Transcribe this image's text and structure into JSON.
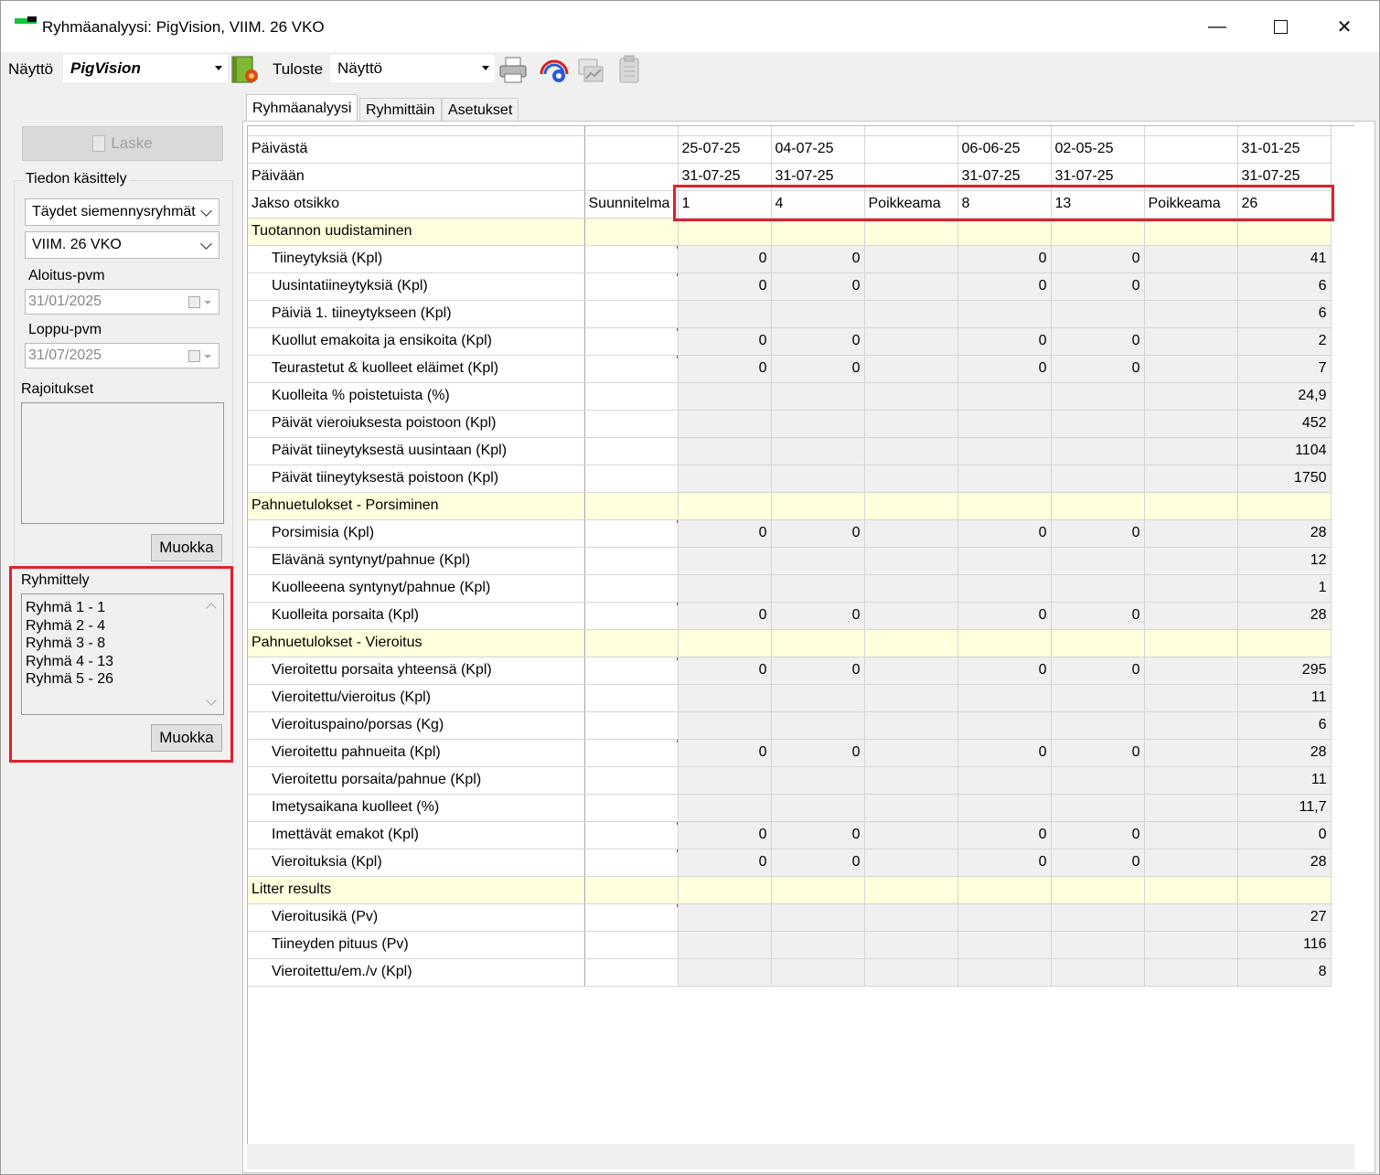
{
  "window": {
    "title": "Ryhmäanalyysi: PigVision, VIIM. 26 VKO",
    "minimize": "—",
    "close": "✕"
  },
  "toolbar": {
    "nayto_label": "Näyttö",
    "view_value": "PigVision",
    "tuloste_label": "Tuloste",
    "print_value": "Näyttö"
  },
  "left": {
    "laske_label": "Laske",
    "tiedon_kasittely": "Tiedon käsittely",
    "group_select": "Täydet siemennysryhmät",
    "period_select": "VIIM. 26 VKO",
    "aloitus_label": "Aloitus-pvm",
    "aloitus_value": "31/01/2025",
    "loppu_label": "Loppu-pvm",
    "loppu_value": "31/07/2025",
    "rajoitukset_label": "Rajoitukset",
    "muokka1": "Muokka",
    "ryhmittely_label": "Ryhmittely",
    "ryhmittely_items": [
      "Ryhmä 1 - 1",
      "Ryhmä 2 - 4",
      "Ryhmä 3 - 8",
      "Ryhmä 4 - 13",
      "Ryhmä 5 - 26"
    ],
    "muokka2": "Muokka"
  },
  "tabs": [
    "Ryhmäanalyysi",
    "Ryhmittäin",
    "Asetukset"
  ],
  "grid": {
    "header_rows": [
      {
        "label": "Päivästä",
        "plan": "",
        "cols": [
          "25-07-25",
          "04-07-25",
          "",
          "06-06-25",
          "02-05-25",
          "",
          "31-01-25"
        ]
      },
      {
        "label": "Päivään",
        "plan": "",
        "cols": [
          "31-07-25",
          "31-07-25",
          "",
          "31-07-25",
          "31-07-25",
          "",
          "31-07-25"
        ]
      },
      {
        "label": "Jakso otsikko",
        "plan": "Suunnitelma",
        "cols": [
          "1",
          "4",
          "Poikkeama",
          "8",
          "13",
          "Poikkeama",
          "26"
        ]
      }
    ],
    "sections": [
      {
        "title": "Tuotannon uudistaminen",
        "rows": [
          {
            "label": "Tiineytyksiä (Kpl)",
            "vals": [
              "0",
              "0",
              "",
              "0",
              "0",
              "",
              "41"
            ]
          },
          {
            "label": "Uusintatiineytyksiä (Kpl)",
            "vals": [
              "0",
              "0",
              "",
              "0",
              "0",
              "",
              "6"
            ]
          },
          {
            "label": "Päiviä 1. tiineytykseen (Kpl)",
            "vals": [
              "",
              "",
              "",
              "",
              "",
              "",
              "6"
            ]
          },
          {
            "label": "Kuollut emakoita ja ensikoita (Kpl)",
            "vals": [
              "0",
              "0",
              "",
              "0",
              "0",
              "",
              "2"
            ]
          },
          {
            "label": "Teurastetut & kuolleet eläimet (Kpl)",
            "vals": [
              "0",
              "0",
              "",
              "0",
              "0",
              "",
              "7"
            ]
          },
          {
            "label": "Kuolleita % poistetuista (%)",
            "vals": [
              "",
              "",
              "",
              "",
              "",
              "",
              "24,9"
            ]
          },
          {
            "label": "Päivät vieroiuksesta poistoon (Kpl)",
            "vals": [
              "",
              "",
              "",
              "",
              "",
              "",
              "452"
            ]
          },
          {
            "label": "Päivät tiineytyksestä uusintaan (Kpl)",
            "vals": [
              "",
              "",
              "",
              "",
              "",
              "",
              "1104"
            ]
          },
          {
            "label": "Päivät tiineytyksestä poistoon (Kpl)",
            "vals": [
              "",
              "",
              "",
              "",
              "",
              "",
              "1750"
            ]
          }
        ]
      },
      {
        "title": "Pahnuetulokset - Porsiminen",
        "rows": [
          {
            "label": "Porsimisia (Kpl)",
            "vals": [
              "0",
              "0",
              "",
              "0",
              "0",
              "",
              "28"
            ]
          },
          {
            "label": "Elävänä syntynyt/pahnue (Kpl)",
            "vals": [
              "",
              "",
              "",
              "",
              "",
              "",
              "12"
            ]
          },
          {
            "label": "Kuolleeena syntynyt/pahnue (Kpl)",
            "vals": [
              "",
              "",
              "",
              "",
              "",
              "",
              "1"
            ]
          },
          {
            "label": "Kuolleita porsaita (Kpl)",
            "vals": [
              "0",
              "0",
              "",
              "0",
              "0",
              "",
              "28"
            ]
          }
        ]
      },
      {
        "title": "Pahnuetulokset - Vieroitus",
        "rows": [
          {
            "label": "Vieroitettu porsaita yhteensä (Kpl)",
            "vals": [
              "0",
              "0",
              "",
              "0",
              "0",
              "",
              "295"
            ]
          },
          {
            "label": "Vieroitettu/vieroitus (Kpl)",
            "vals": [
              "",
              "",
              "",
              "",
              "",
              "",
              "11"
            ]
          },
          {
            "label": "Vieroituspaino/porsas (Kg)",
            "vals": [
              "",
              "",
              "",
              "",
              "",
              "",
              "6"
            ]
          },
          {
            "label": "Vieroitettu pahnueita (Kpl)",
            "vals": [
              "0",
              "0",
              "",
              "0",
              "0",
              "",
              "28"
            ]
          },
          {
            "label": "Vieroitettu porsaita/pahnue (Kpl)",
            "vals": [
              "",
              "",
              "",
              "",
              "",
              "",
              "11"
            ]
          },
          {
            "label": "Imetysaikana kuolleet (%)",
            "vals": [
              "",
              "",
              "",
              "",
              "",
              "",
              "11,7"
            ]
          },
          {
            "label": "Imettävät emakot (Kpl)",
            "vals": [
              "0",
              "0",
              "",
              "0",
              "0",
              "",
              "0"
            ]
          },
          {
            "label": "Vieroituksia (Kpl)",
            "vals": [
              "0",
              "0",
              "",
              "0",
              "0",
              "",
              "28"
            ]
          }
        ]
      },
      {
        "title": "Litter results",
        "rows": [
          {
            "label": "Vieroitusikä (Pv)",
            "vals": [
              "",
              "",
              "",
              "",
              "",
              "",
              "27"
            ]
          },
          {
            "label": "Tiineyden pituus (Pv)",
            "vals": [
              "",
              "",
              "",
              "",
              "",
              "",
              "116"
            ]
          },
          {
            "label": "Vieroitettu/em./v (Kpl)",
            "vals": [
              "",
              "",
              "",
              "",
              "",
              "",
              "8"
            ]
          }
        ]
      }
    ]
  },
  "colors": {
    "highlight": "#e0202a",
    "section_bg": "#ffffdd",
    "cell_bg": "#f0f0f0"
  }
}
